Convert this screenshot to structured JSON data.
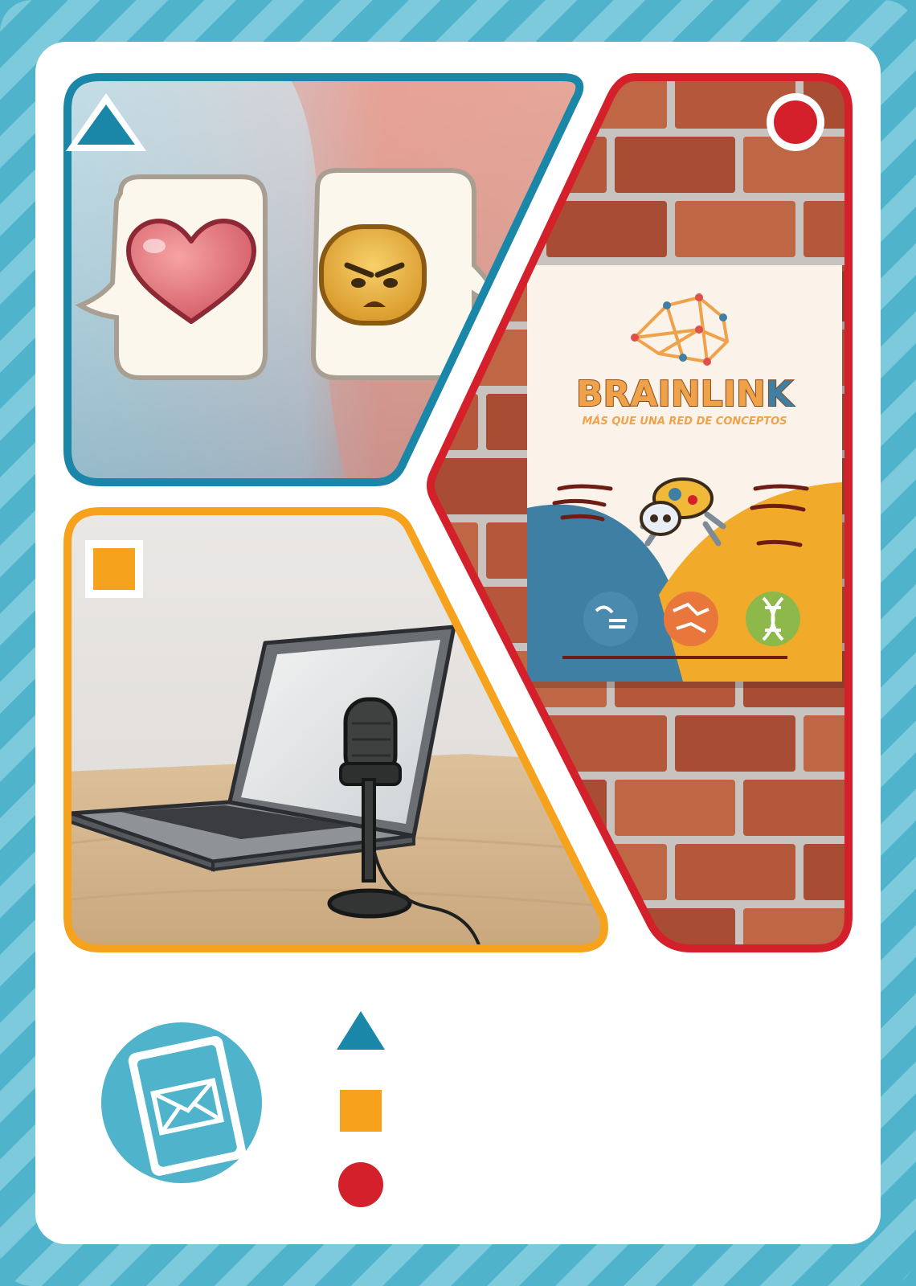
{
  "colors": {
    "frame": "#4fb3cc",
    "frame_stripe": "#7ccadc",
    "card": "#ffffff",
    "triangle": "#1a86a8",
    "square": "#f7a21c",
    "circle": "#d4202a",
    "poster_blue": "#3f7fa3",
    "poster_yellow": "#f1aa2a",
    "brick": "#b5573b"
  },
  "panels": {
    "top_left": {
      "symbol": "triangle",
      "icons": [
        "heart-icon",
        "angry-face-icon"
      ]
    },
    "bottom_left": {
      "symbol": "square",
      "icons": [
        "laptop-icon",
        "microphone-icon"
      ]
    },
    "right": {
      "symbol": "circle",
      "poster": {
        "title_part1": "BRAINLIN",
        "title_part2": "K",
        "subtitle": "MÁS QUE UNA RED DE CONCEPTOS",
        "icons": [
          "brain-network-icon",
          "spider-mascot-icon",
          "speech-heads-icon",
          "world-map-icon",
          "dna-icon"
        ]
      }
    }
  },
  "footer": {
    "badge_icon": "mail-card-icon",
    "legend_symbols": [
      "triangle",
      "square",
      "circle"
    ]
  }
}
